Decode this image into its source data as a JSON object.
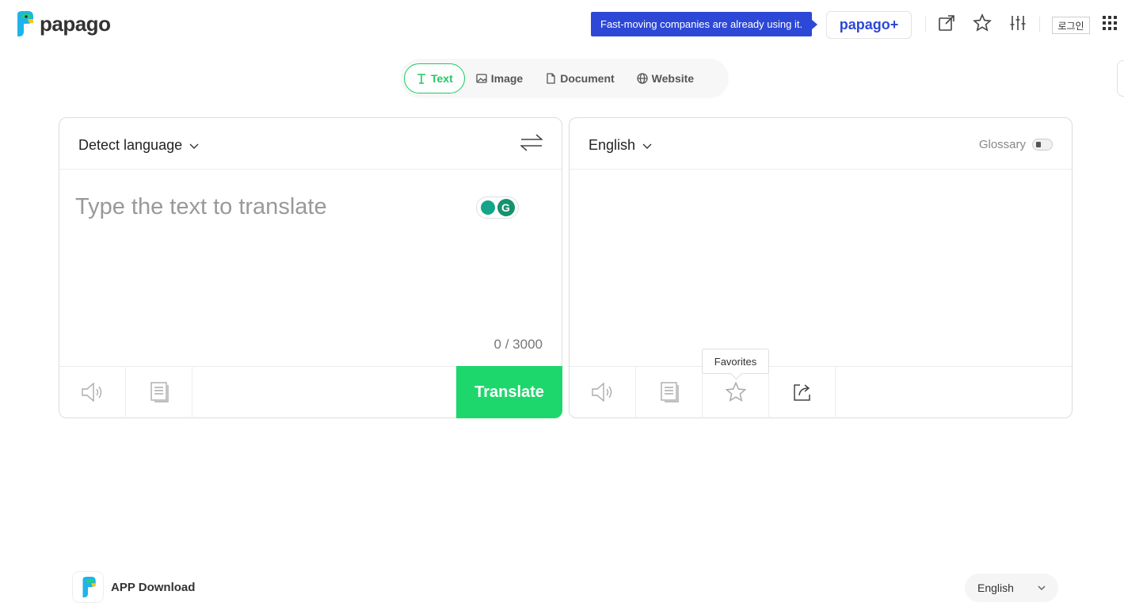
{
  "header": {
    "logo_text": "papago",
    "promo_text": "Fast-moving companies are already using it.",
    "plus_label": "papago+",
    "login_label": "로그인",
    "icons": [
      "external-link-icon",
      "star-icon",
      "settings-sliders-icon",
      "apps-grid-icon"
    ]
  },
  "tabs": [
    {
      "label": "Text",
      "icon": "text-icon",
      "active": true
    },
    {
      "label": "Image",
      "icon": "image-icon",
      "active": false
    },
    {
      "label": "Document",
      "icon": "document-icon",
      "active": false
    },
    {
      "label": "Website",
      "icon": "globe-icon",
      "active": false
    }
  ],
  "source": {
    "language": "Detect language",
    "placeholder": "Type the text to translate",
    "counter": "0 / 3000",
    "translate_label": "Translate"
  },
  "target": {
    "language": "English",
    "glossary_label": "Glossary"
  },
  "tooltip": {
    "favorites": "Favorites"
  },
  "footer": {
    "app_download": "APP Download",
    "language": "English"
  },
  "colors": {
    "accent_green": "#1ed76c",
    "promo_blue": "#2d48d6"
  }
}
